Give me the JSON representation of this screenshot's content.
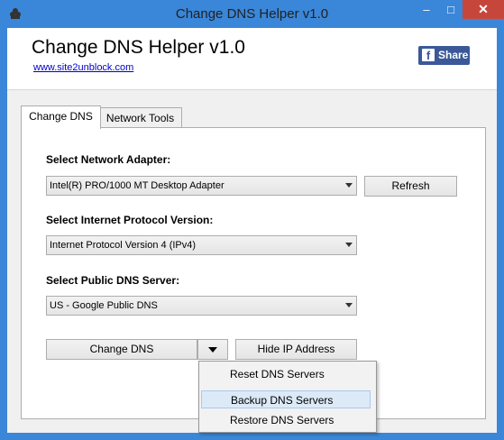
{
  "window": {
    "title": "Change DNS Helper v1.0",
    "min_glyph": "–",
    "max_glyph": "□",
    "close_glyph": "✕"
  },
  "header": {
    "title": "Change DNS Helper v1.0",
    "link": "www.site2unblock.com",
    "share_label": "Share"
  },
  "tabs": [
    {
      "label": "Change DNS",
      "active": true
    },
    {
      "label": "Network Tools",
      "active": false
    }
  ],
  "adapter": {
    "label": "Select Network Adapter:",
    "value": "Intel(R) PRO/1000 MT Desktop Adapter",
    "refresh_label": "Refresh"
  },
  "protocol": {
    "label": "Select Internet Protocol Version:",
    "value": "Internet Protocol Version 4 (IPv4)"
  },
  "dns": {
    "label": "Select Public DNS Server:",
    "value": "US - Google Public DNS"
  },
  "actions": {
    "change_dns_label": "Change DNS",
    "hide_ip_label": "Hide IP Address"
  },
  "menu": {
    "items": [
      "Reset DNS Servers",
      "Backup DNS Servers",
      "Restore DNS Servers"
    ],
    "highlighted": 1
  },
  "colors": {
    "titlebar": "#3a86d8",
    "close": "#c7463c",
    "facebook": "#3b5998",
    "link": "#0000cc"
  },
  "icons": {
    "app": "app-icon",
    "facebook": "facebook-icon",
    "dropdown": "dropdown-arrow-icon"
  }
}
